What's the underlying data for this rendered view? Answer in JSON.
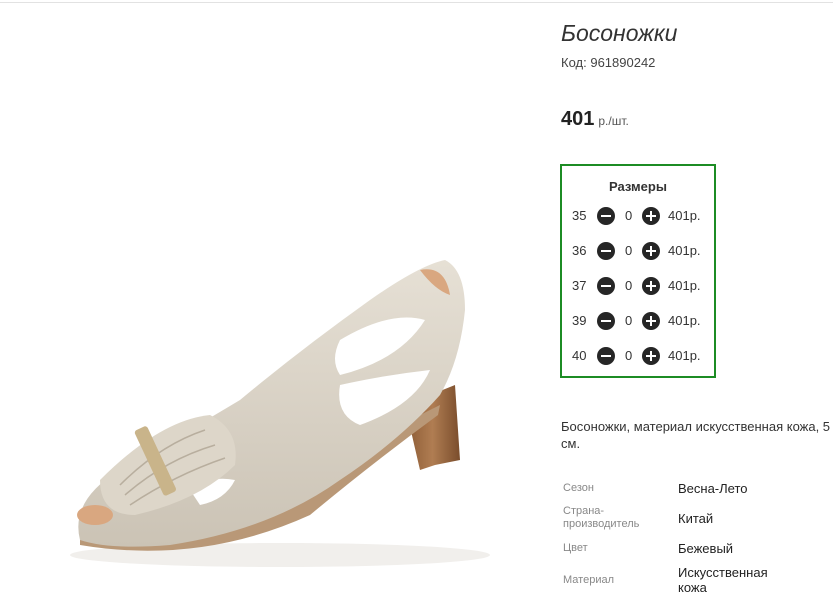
{
  "product": {
    "title": "Босоножки",
    "code_label": "Код:",
    "code": "961890242",
    "price": "401",
    "price_unit": "р./шт.",
    "image_alt": "Бежевые босоножки"
  },
  "sizes": {
    "title": "Размеры",
    "rows": [
      {
        "size": "35",
        "qty": "0",
        "price": "401р."
      },
      {
        "size": "36",
        "qty": "0",
        "price": "401р."
      },
      {
        "size": "37",
        "qty": "0",
        "price": "401р."
      },
      {
        "size": "39",
        "qty": "0",
        "price": "401р."
      },
      {
        "size": "40",
        "qty": "0",
        "price": "401р."
      }
    ]
  },
  "description": "Босоножки, материал искусственная кожа, 5 см.",
  "properties": [
    {
      "label": "Сезон",
      "value": "Весна-Лето"
    },
    {
      "label": "Страна-производитель",
      "value": "Китай"
    },
    {
      "label": "Цвет",
      "value": "Бежевый"
    },
    {
      "label": "Материал",
      "value": "Искусственная кожа"
    }
  ],
  "colors": {
    "border_accent": "#1c8c24",
    "button": "#262626"
  },
  "icons": {
    "minus": "minus-circle-icon",
    "plus": "plus-circle-icon"
  }
}
